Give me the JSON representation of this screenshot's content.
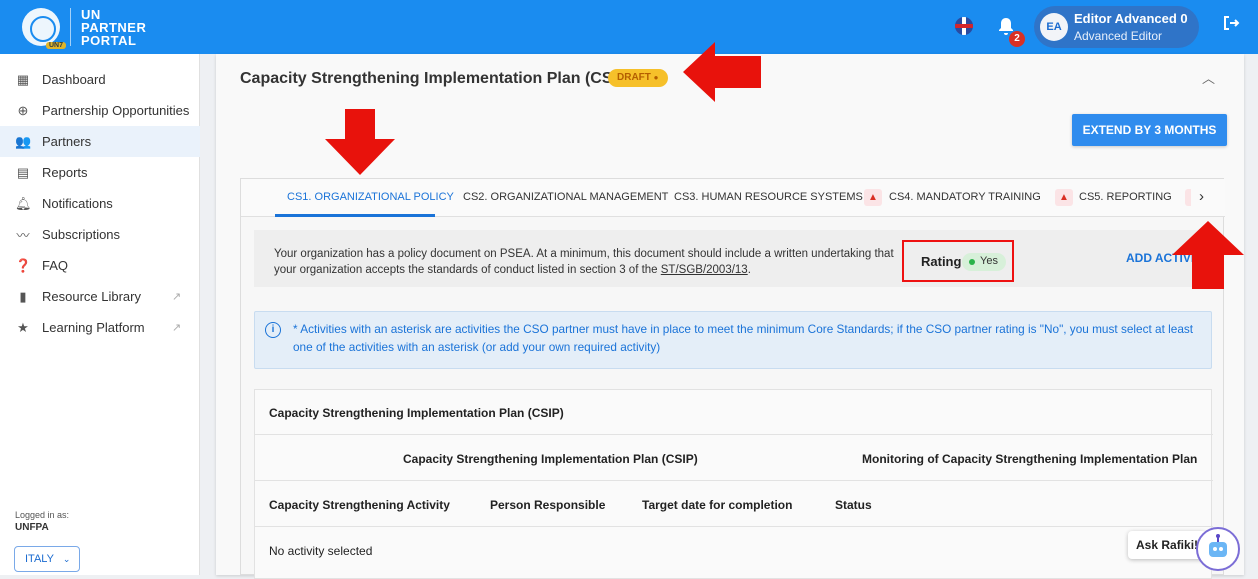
{
  "topbar": {
    "logo_badge": "UN7",
    "logo_line1": "UN",
    "logo_line2": "PARTNER",
    "logo_line3": "PORTAL",
    "notifications_count": "2",
    "user_initials": "EA",
    "user_name": "Editor Advanced 0",
    "user_role": "Advanced Editor"
  },
  "sidebar": {
    "items": [
      {
        "label": "Dashboard",
        "icon": "dashboard-icon"
      },
      {
        "label": "Partnership Opportunities",
        "icon": "globe-icon"
      },
      {
        "label": "Partners",
        "icon": "people-icon"
      },
      {
        "label": "Reports",
        "icon": "report-icon"
      },
      {
        "label": "Notifications",
        "icon": "bell-icon"
      },
      {
        "label": "Subscriptions",
        "icon": "rss-icon"
      },
      {
        "label": "FAQ",
        "icon": "help-icon"
      },
      {
        "label": "Resource Library",
        "icon": "book-icon"
      },
      {
        "label": "Learning Platform",
        "icon": "star-icon"
      }
    ],
    "logged_in_label": "Logged in as:",
    "organization": "UNFPA",
    "country": "ITALY"
  },
  "main": {
    "title": "Capacity Strengthening Implementation Plan (CSIP)",
    "status_badge": "DRAFT",
    "extend_button": "EXTEND BY 3 MONTHS",
    "tabs": [
      {
        "label": "CS1. ORGANIZATIONAL POLICY",
        "warning": false
      },
      {
        "label": "CS2. ORGANIZATIONAL MANAGEMENT",
        "warning": false
      },
      {
        "label": "CS3. HUMAN RESOURCE SYSTEMS",
        "warning": false
      },
      {
        "label": "CS4. MANDATORY TRAINING",
        "warning": true
      },
      {
        "label": "CS5. REPORTING",
        "warning": true
      }
    ],
    "standard": {
      "text_before": "Your organization has a policy document on PSEA. At a minimum, this document should include a written undertaking that your organization accepts the standards of conduct listed in section 3 of the ",
      "link": "ST/SGB/2003/13",
      "text_after": ".",
      "rating_label": "Rating",
      "rating_value": "Yes",
      "add_activity": "ADD ACTIVITY"
    },
    "info_text": "* Activities with an asterisk are activities the CSO partner must have in place to meet the minimum Core Standards; if the CSO partner rating is \"No\", you must select at least one of the activities with an asterisk (or add your own required activity)",
    "table": {
      "title": "Capacity Strengthening Implementation Plan (CSIP)",
      "group_left": "Capacity Strengthening Implementation Plan (CSIP)",
      "group_right": "Monitoring of Capacity Strengthening Implementation Plan",
      "columns": [
        "Capacity Strengthening Activity",
        "Person Responsible",
        "Target date for completion",
        "Status"
      ],
      "empty_text": "No activity selected"
    }
  },
  "assistant": {
    "label": "Ask Rafiki!"
  },
  "colors": {
    "primary": "#1a8cf0",
    "accent": "#1a73d8",
    "draft": "#f6c02a",
    "annotation": "#e8120c"
  }
}
